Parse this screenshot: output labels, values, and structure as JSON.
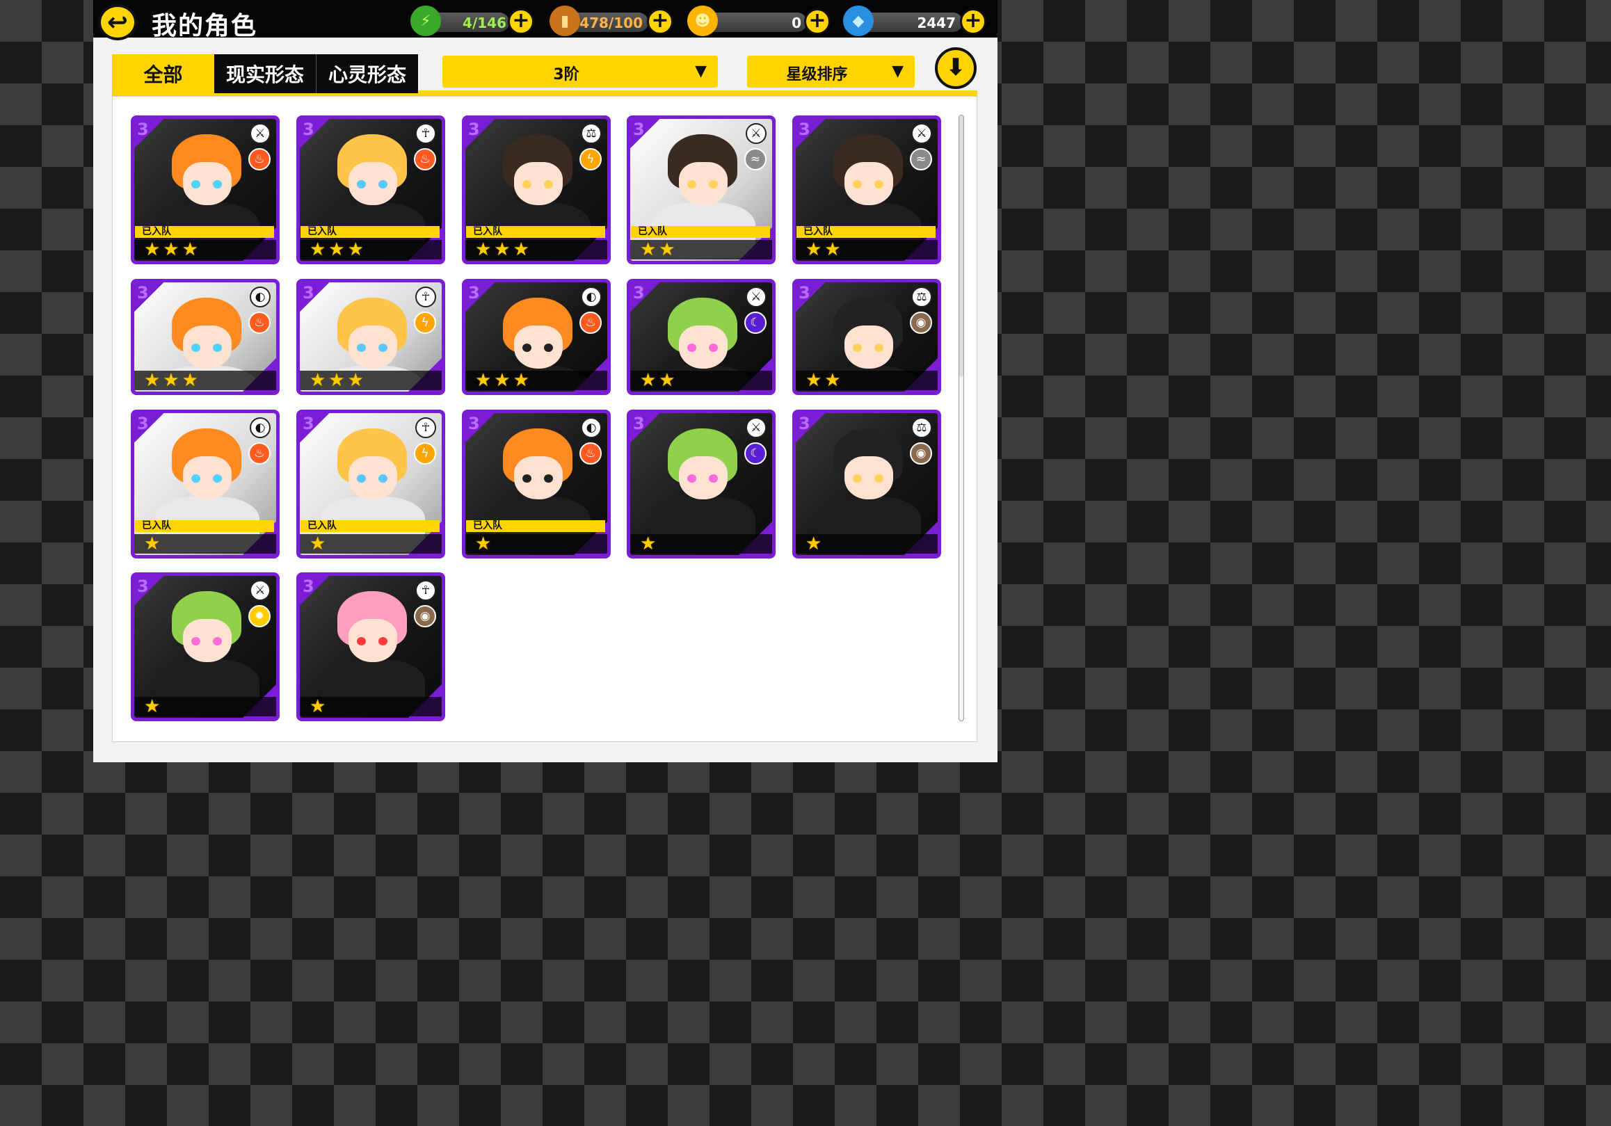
{
  "header": {
    "title": "我的角色",
    "back_icon": "back-arrow-icon"
  },
  "resources": [
    {
      "name": "stamina",
      "icon": "lightning-bolt-icon",
      "value": "4/146",
      "color": "#9ef04a"
    },
    {
      "name": "energy",
      "icon": "battery-icon",
      "value": "478/100",
      "color": "#ffb347"
    },
    {
      "name": "coins",
      "icon": "coin-icon",
      "value": "0",
      "color": "#ffd400"
    },
    {
      "name": "gems",
      "icon": "gem-icon",
      "value": "2447",
      "color": "#7fd3ff"
    }
  ],
  "tabs": [
    {
      "label": "全部",
      "active": true
    },
    {
      "label": "现实形态",
      "active": false
    },
    {
      "label": "心灵形态",
      "active": false
    }
  ],
  "filters": {
    "tier": "3阶",
    "sort": "星级排序"
  },
  "cards": [
    {
      "rank": "3",
      "team": "已入队",
      "stars": 3,
      "class_icon": "sword-icon",
      "element_icon": "fire-icon",
      "element_color": "#ff5a1f",
      "hair_color": "#ff8a1f",
      "eye_color": "#4fd2ff",
      "bg": "dark"
    },
    {
      "rank": "3",
      "team": "已入队",
      "stars": 3,
      "class_icon": "ankh-icon",
      "element_icon": "fire-icon",
      "element_color": "#ff5a1f",
      "hair_color": "#ffc34a",
      "eye_color": "#5ac8ff",
      "bg": "dark"
    },
    {
      "rank": "3",
      "team": "已入队",
      "stars": 3,
      "class_icon": "scales-icon",
      "element_icon": "lightning-icon",
      "element_color": "#ffa500",
      "hair_color": "#3a2a22",
      "eye_color": "#ffd15a",
      "bg": "dark"
    },
    {
      "rank": "3",
      "team": "已入队",
      "stars": 2,
      "class_icon": "sword-icon",
      "element_icon": "wind-icon",
      "element_color": "#8a8a8a",
      "hair_color": "#3a2a22",
      "eye_color": "#ffd15a",
      "bg": "light"
    },
    {
      "rank": "3",
      "team": "已入队",
      "stars": 2,
      "class_icon": "sword-icon",
      "element_icon": "wind-icon",
      "element_color": "#8a8a8a",
      "hair_color": "#3a2a22",
      "eye_color": "#ffd15a",
      "bg": "dark"
    },
    {
      "rank": "3",
      "team": "",
      "stars": 3,
      "class_icon": "shield-icon",
      "element_icon": "fire-icon",
      "element_color": "#ff5a1f",
      "hair_color": "#ff8a1f",
      "eye_color": "#4fd2ff",
      "bg": "light"
    },
    {
      "rank": "3",
      "team": "",
      "stars": 3,
      "class_icon": "ankh-icon",
      "element_icon": "lightning-icon",
      "element_color": "#ffa500",
      "hair_color": "#ffc34a",
      "eye_color": "#5ac8ff",
      "bg": "light"
    },
    {
      "rank": "3",
      "team": "",
      "stars": 3,
      "class_icon": "shield-icon",
      "element_icon": "fire-icon",
      "element_color": "#ff5a1f",
      "hair_color": "#ff8a1f",
      "eye_color": "#222222",
      "bg": "dark"
    },
    {
      "rank": "3",
      "team": "",
      "stars": 2,
      "class_icon": "sword-icon",
      "element_icon": "moon-icon",
      "element_color": "#5a1ed6",
      "hair_color": "#8fd14a",
      "eye_color": "#ff6adf",
      "bg": "dark"
    },
    {
      "rank": "3",
      "team": "",
      "stars": 2,
      "class_icon": "scales-icon",
      "element_icon": "earth-icon",
      "element_color": "#8a6a4a",
      "hair_color": "#222222",
      "eye_color": "#ffd15a",
      "bg": "dark"
    },
    {
      "rank": "3",
      "team": "已入队",
      "stars": 1,
      "class_icon": "shield-icon",
      "element_icon": "fire-icon",
      "element_color": "#ff5a1f",
      "hair_color": "#ff8a1f",
      "eye_color": "#4fd2ff",
      "bg": "light"
    },
    {
      "rank": "3",
      "team": "已入队",
      "stars": 1,
      "class_icon": "ankh-icon",
      "element_icon": "lightning-icon",
      "element_color": "#ffa500",
      "hair_color": "#ffc34a",
      "eye_color": "#5ac8ff",
      "bg": "light"
    },
    {
      "rank": "3",
      "team": "已入队",
      "stars": 1,
      "class_icon": "shield-icon",
      "element_icon": "fire-icon",
      "element_color": "#ff5a1f",
      "hair_color": "#ff8a1f",
      "eye_color": "#222222",
      "bg": "dark"
    },
    {
      "rank": "3",
      "team": "",
      "stars": 1,
      "class_icon": "sword-icon",
      "element_icon": "moon-icon",
      "element_color": "#5a1ed6",
      "hair_color": "#8fd14a",
      "eye_color": "#ff6adf",
      "bg": "dark"
    },
    {
      "rank": "3",
      "team": "",
      "stars": 1,
      "class_icon": "scales-icon",
      "element_icon": "earth-icon",
      "element_color": "#8a6a4a",
      "hair_color": "#222222",
      "eye_color": "#ffd15a",
      "bg": "dark"
    },
    {
      "rank": "3",
      "team": "",
      "stars": 1,
      "class_icon": "sword-icon",
      "element_icon": "sun-icon",
      "element_color": "#ffcc00",
      "hair_color": "#8fd14a",
      "eye_color": "#ff6adf",
      "bg": "dark"
    },
    {
      "rank": "3",
      "team": "",
      "stars": 1,
      "class_icon": "ankh-icon",
      "element_icon": "earth-icon",
      "element_color": "#8a6a4a",
      "hair_color": "#ff9fbf",
      "eye_color": "#ff3a3a",
      "bg": "dark"
    }
  ]
}
